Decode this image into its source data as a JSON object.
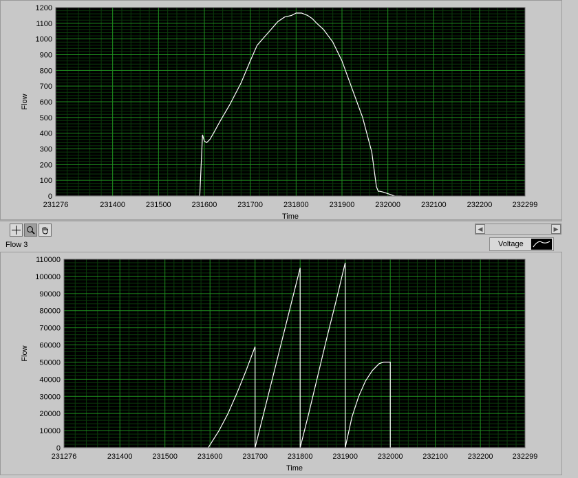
{
  "colors": {
    "plot_bg": "#000000",
    "grid_major": "#1f8f1f",
    "grid_minor": "#0b3a0b",
    "trace": "#ffffff"
  },
  "toolbar": {
    "cursor_icon": "cursor-crosshair-icon",
    "zoom_icon": "zoom-icon",
    "pan_icon": "pan-hand-icon"
  },
  "plot_label": "Flow 3",
  "legend": {
    "label": "Voltage",
    "swatch_icon": "line-plot-icon"
  },
  "chart_data": [
    {
      "type": "line",
      "xlabel": "Time",
      "ylabel": "Flow",
      "xlim": [
        231276,
        232299
      ],
      "ylim": [
        0,
        1200
      ],
      "xticks": [
        "231276",
        "231400",
        "231500",
        "231600",
        "231700",
        "231800",
        "231900",
        "232000",
        "232100",
        "232200",
        "232299"
      ],
      "yticks": [
        "0",
        "100",
        "200",
        "300",
        "400",
        "500",
        "600",
        "700",
        "800",
        "900",
        "1000",
        "1100",
        "1200"
      ],
      "grid": true,
      "x": [
        231276,
        231590,
        231596,
        231600,
        231605,
        231612,
        231620,
        231635,
        231655,
        231680,
        231700,
        231715,
        231730,
        231745,
        231760,
        231775,
        231790,
        231800,
        231812,
        231825,
        231835,
        231845,
        231860,
        231880,
        231900,
        231920,
        231945,
        231965,
        231975,
        231979,
        231982,
        231990,
        232005,
        232015,
        232030
      ],
      "y": [
        0,
        0,
        390,
        350,
        340,
        360,
        400,
        480,
        580,
        720,
        860,
        960,
        1010,
        1060,
        1110,
        1140,
        1150,
        1165,
        1165,
        1150,
        1130,
        1100,
        1060,
        980,
        860,
        700,
        500,
        280,
        60,
        30,
        30,
        25,
        10,
        0,
        0
      ]
    },
    {
      "type": "line",
      "xlabel": "Time",
      "ylabel": "Flow",
      "xlim": [
        231276,
        232299
      ],
      "ylim": [
        0,
        110000
      ],
      "xticks": [
        "231276",
        "231400",
        "231500",
        "231600",
        "231700",
        "231800",
        "231900",
        "232000",
        "232100",
        "232200",
        "232299"
      ],
      "yticks": [
        "0",
        "10000",
        "20000",
        "30000",
        "40000",
        "50000",
        "60000",
        "70000",
        "80000",
        "90000",
        "100000",
        "110000"
      ],
      "grid": true,
      "x": [
        231276,
        231596,
        231620,
        231640,
        231660,
        231680,
        231700,
        231700,
        231720,
        231740,
        231760,
        231780,
        231800,
        231800,
        231820,
        231840,
        231860,
        231880,
        231900,
        231900,
        231915,
        231930,
        231945,
        231960,
        231975,
        231985,
        232000,
        232000,
        232299
      ],
      "y": [
        0,
        0,
        10000,
        20000,
        32000,
        45000,
        59000,
        0,
        21000,
        42000,
        63000,
        84000,
        105000,
        0,
        21000,
        43000,
        65000,
        86000,
        108000,
        0,
        18000,
        30000,
        39000,
        45000,
        49000,
        50000,
        50000,
        0,
        0
      ]
    }
  ]
}
